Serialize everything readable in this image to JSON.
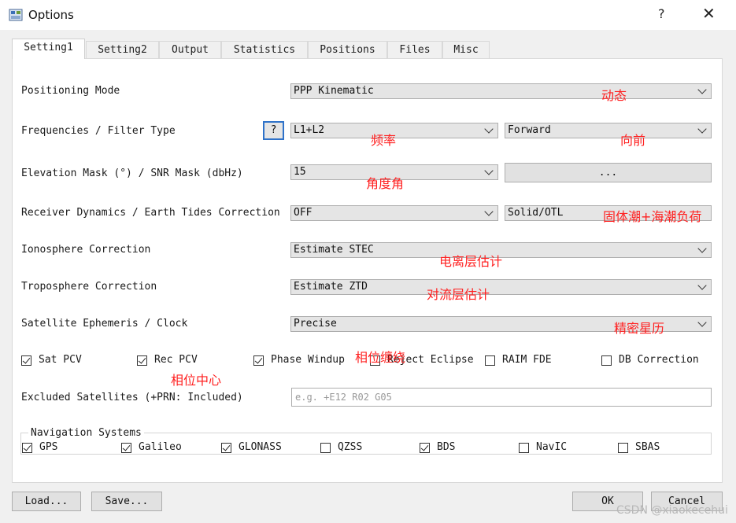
{
  "window": {
    "title": "Options",
    "help_glyph": "?",
    "close_glyph": "✕"
  },
  "tabs": [
    "Setting1",
    "Setting2",
    "Output",
    "Statistics",
    "Positions",
    "Files",
    "Misc"
  ],
  "rows": {
    "positioning_mode": {
      "label": "Positioning Mode",
      "value": "PPP Kinematic"
    },
    "frequencies": {
      "label": "Frequencies / Filter Type",
      "freq": "L1+L2",
      "filter": "Forward",
      "help": "?"
    },
    "elevation": {
      "label": "Elevation Mask (°) / SNR Mask (dbHz)",
      "value": "15",
      "snr_button": "..."
    },
    "receiver": {
      "label": "Receiver Dynamics / Earth Tides Correction",
      "dynamics": "OFF",
      "tides": "Solid/OTL"
    },
    "ionosphere": {
      "label": "Ionosphere Correction",
      "value": "Estimate STEC"
    },
    "troposphere": {
      "label": "Troposphere Correction",
      "value": "Estimate ZTD"
    },
    "ephemeris": {
      "label": "Satellite Ephemeris / Clock",
      "value": "Precise"
    }
  },
  "checks": {
    "sat_pcv": "Sat PCV",
    "rec_pcv": "Rec PCV",
    "phase_windup": "Phase Windup",
    "reject_eclipse": "Reject Eclipse",
    "raim_fde": "RAIM FDE",
    "db_correction": "DB Correction"
  },
  "excluded": {
    "label": "Excluded Satellites (+PRN: Included)",
    "placeholder": "e.g.  +E12 R02 G05"
  },
  "navigation": {
    "title": "Navigation Systems",
    "gps": "GPS",
    "galileo": "Galileo",
    "glonass": "GLONASS",
    "qzss": "QZSS",
    "bds": "BDS",
    "navic": "NavIC",
    "sbas": "SBAS"
  },
  "buttons": {
    "load": "Load...",
    "save": "Save...",
    "ok": "OK",
    "cancel": "Cancel"
  },
  "annotations": {
    "mode": "动态",
    "freq": "频率",
    "filter": "向前",
    "elev": "角度角",
    "tides": "固体潮+海潮负荷",
    "iono": "电离层估计",
    "tropo": "对流层估计",
    "ephem": "精密星历",
    "windup": "相位缠绕",
    "pcv": "相位中心"
  },
  "watermark": "CSDN @xiaokecehui",
  "colors": {
    "annotation": "#ff2020",
    "help_border": "#2f72c9"
  }
}
